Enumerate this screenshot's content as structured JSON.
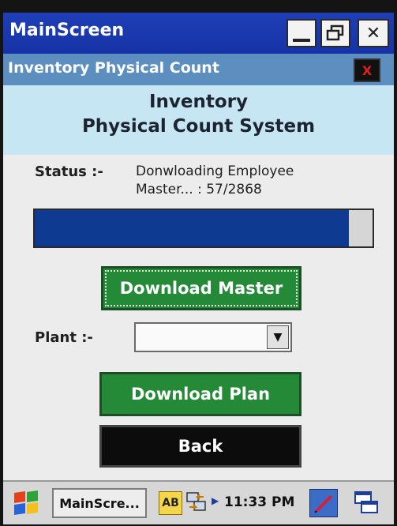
{
  "window": {
    "title": "MainScreen"
  },
  "form": {
    "title": "Inventory Physical Count"
  },
  "heading": {
    "line1": "Inventory",
    "line2": "Physical Count System"
  },
  "status": {
    "label": "Status :-",
    "line1": "Donwloading Employee",
    "line2": "Master... : 57/2868",
    "progress_fraction": 0.93
  },
  "buttons": {
    "download_master": "Download Master",
    "download_plan": "Download Plan",
    "back": "Back"
  },
  "plant": {
    "label": "Plant :-",
    "selected": ""
  },
  "taskbar": {
    "task_label": "MainScre...",
    "ime_label": "AB",
    "clock": "11:33 PM"
  },
  "colors": {
    "titlebar": "#1633a6",
    "subbar": "#5d8ec0",
    "heading_band": "#c6e6f4",
    "progress_fill": "#0e3a92",
    "green_button": "#248a37",
    "black_button": "#0c0c0c"
  }
}
